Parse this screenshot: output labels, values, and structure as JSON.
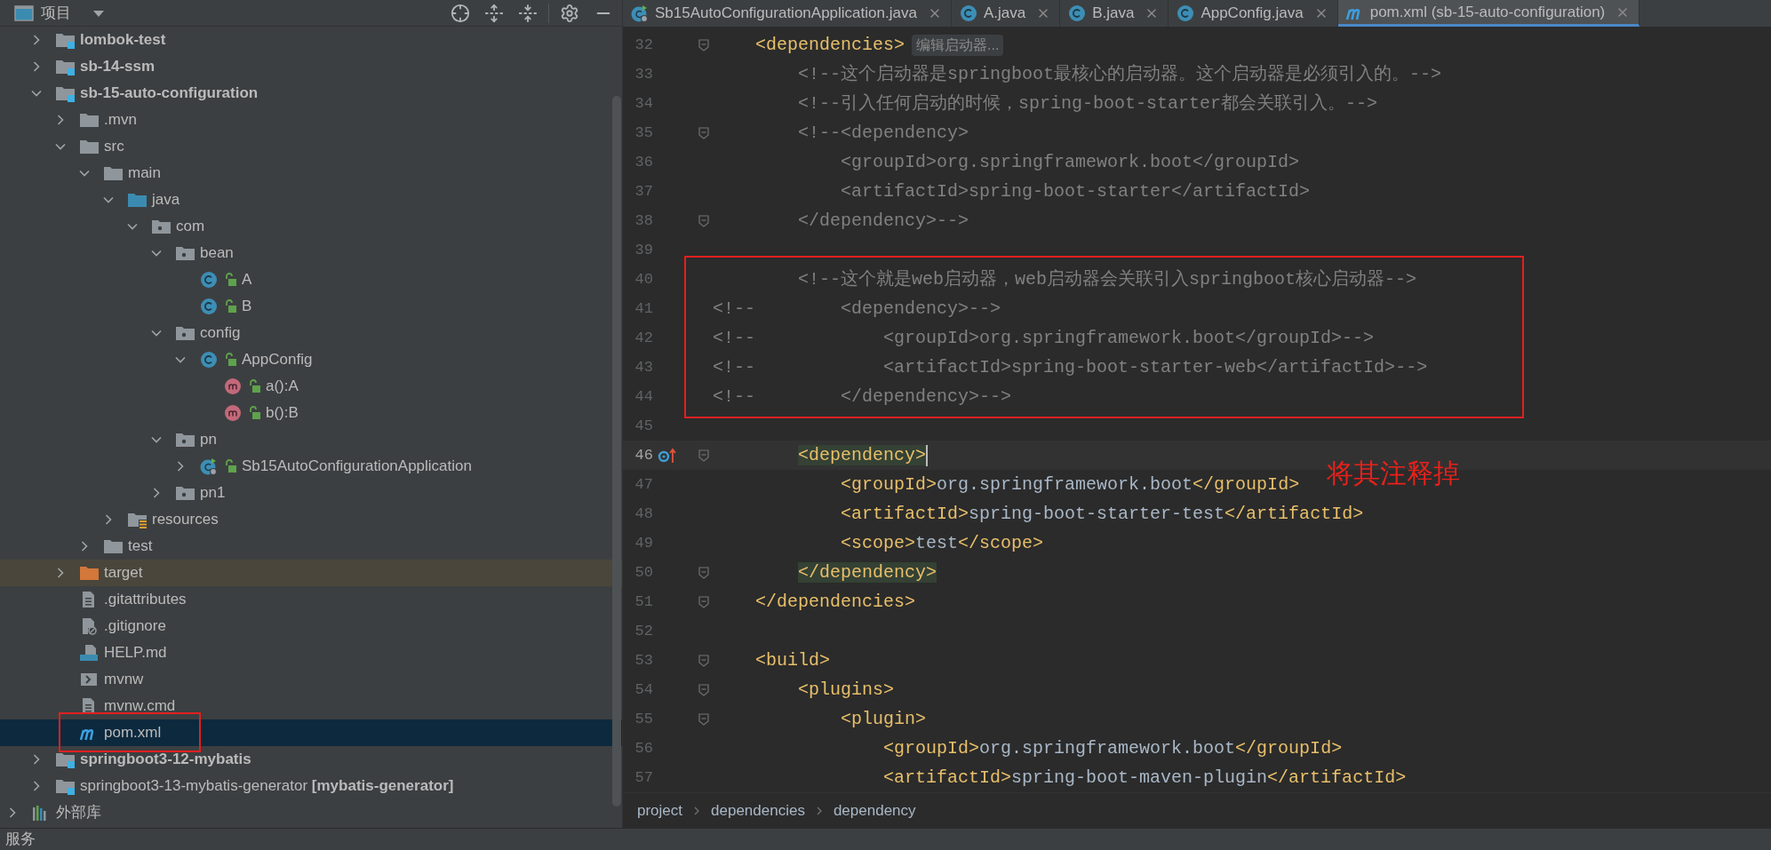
{
  "project_panel": {
    "title": "项目"
  },
  "tree": [
    {
      "label": "lombok-test",
      "kind": "module",
      "bold": true,
      "expanded": false,
      "selected": false
    },
    {
      "label": "sb-14-ssm",
      "kind": "module",
      "bold": true,
      "expanded": false,
      "selected": false
    },
    {
      "label": "sb-15-auto-configuration",
      "kind": "module",
      "bold": true,
      "expanded": true,
      "selected": false,
      "children": [
        {
          "label": ".mvn",
          "kind": "folder",
          "expanded": false,
          "selected": false
        },
        {
          "label": "src",
          "kind": "folder",
          "expanded": true,
          "selected": false,
          "children": [
            {
              "label": "main",
              "kind": "folder",
              "expanded": true,
              "selected": false,
              "children": [
                {
                  "label": "java",
                  "kind": "source_folder",
                  "expanded": true,
                  "selected": false,
                  "children": [
                    {
                      "label": "com",
                      "kind": "package",
                      "expanded": true,
                      "selected": false,
                      "children": [
                        {
                          "label": "bean",
                          "kind": "package",
                          "expanded": true,
                          "selected": false,
                          "children": [
                            {
                              "label": "A",
                              "kind": "class",
                              "selected": false
                            },
                            {
                              "label": "B",
                              "kind": "class",
                              "selected": false
                            }
                          ]
                        },
                        {
                          "label": "config",
                          "kind": "package",
                          "expanded": true,
                          "selected": false,
                          "children": [
                            {
                              "label": "AppConfig",
                              "kind": "class",
                              "expanded": true,
                              "selected": false,
                              "children": [
                                {
                                  "label": "a():A",
                                  "kind": "method",
                                  "selected": false
                                },
                                {
                                  "label": "b():B",
                                  "kind": "method",
                                  "selected": false
                                }
                              ]
                            }
                          ]
                        },
                        {
                          "label": "pn",
                          "kind": "package",
                          "expanded": true,
                          "selected": false,
                          "children": [
                            {
                              "label": "Sb15AutoConfigurationApplication",
                              "kind": "spring_class",
                              "expanded": false,
                              "selected": false
                            }
                          ]
                        },
                        {
                          "label": "pn1",
                          "kind": "package",
                          "expanded": false,
                          "selected": false
                        }
                      ]
                    }
                  ]
                },
                {
                  "label": "resources",
                  "kind": "resources",
                  "expanded": false,
                  "selected": false
                }
              ]
            },
            {
              "label": "test",
              "kind": "folder",
              "expanded": false,
              "selected": false
            }
          ]
        },
        {
          "label": "target",
          "kind": "excluded",
          "expanded": false,
          "selected": false
        },
        {
          "label": ".gitattributes",
          "kind": "file_text",
          "selected": false
        },
        {
          "label": ".gitignore",
          "kind": "gitignore",
          "selected": false
        },
        {
          "label": "HELP.md",
          "kind": "markdown",
          "selected": false
        },
        {
          "label": "mvnw",
          "kind": "script",
          "selected": false
        },
        {
          "label": "mvnw.cmd",
          "kind": "file_text",
          "selected": false
        },
        {
          "label": "pom.xml",
          "kind": "maven",
          "selected": true
        }
      ]
    },
    {
      "label": "springboot3-12-mybatis",
      "kind": "module",
      "bold": true,
      "expanded": false,
      "selected": false
    },
    {
      "label": "springboot3-13-mybatis-generator **[mybatis-generator]**",
      "kind": "module",
      "bold": false,
      "expanded": false,
      "selected": false
    },
    {
      "label": "外部库",
      "kind": "library",
      "expanded": false,
      "selected": false
    }
  ],
  "editor": {
    "tabs": [
      {
        "label": "Sb15AutoConfigurationApplication.java",
        "kind": "spring_class",
        "selected": false
      },
      {
        "label": "A.java",
        "kind": "class",
        "selected": false
      },
      {
        "label": "B.java",
        "kind": "class",
        "selected": false
      },
      {
        "label": "AppConfig.java",
        "kind": "class",
        "selected": false
      },
      {
        "label": "pom.xml (sb-15-auto-configuration)",
        "kind": "maven",
        "selected": true
      }
    ],
    "lines": [
      {
        "number": "32",
        "fold": true,
        "current": false,
        "gutter_mark": false,
        "segments": [
          {
            "kind": "tag",
            "text": "    <dependencies>"
          },
          {
            "kind": "hint",
            "text": "编辑启动器..."
          }
        ]
      },
      {
        "number": "33",
        "fold": false,
        "current": false,
        "gutter_mark": false,
        "segments": [
          {
            "kind": "comment",
            "text": "        <!--这个启动器是springboot最核心的启动器。这个启动器是必须引入的。-->"
          }
        ]
      },
      {
        "number": "34",
        "fold": false,
        "current": false,
        "gutter_mark": false,
        "segments": [
          {
            "kind": "comment",
            "text": "        <!--引入任何启动的时候，spring-boot-starter都会关联引入。-->"
          }
        ]
      },
      {
        "number": "35",
        "fold": true,
        "current": false,
        "gutter_mark": false,
        "segments": [
          {
            "kind": "comment",
            "text": "        <!--<dependency>"
          }
        ]
      },
      {
        "number": "36",
        "fold": false,
        "current": false,
        "gutter_mark": false,
        "segments": [
          {
            "kind": "comment",
            "text": "            <groupId>org.springframework.boot</groupId>"
          }
        ]
      },
      {
        "number": "37",
        "fold": false,
        "current": false,
        "gutter_mark": false,
        "segments": [
          {
            "kind": "comment",
            "text": "            <artifactId>spring-boot-starter</artifactId>"
          }
        ]
      },
      {
        "number": "38",
        "fold": true,
        "current": false,
        "gutter_mark": false,
        "segments": [
          {
            "kind": "comment",
            "text": "        </dependency>-->"
          }
        ]
      },
      {
        "number": "39",
        "fold": false,
        "current": false,
        "gutter_mark": false
      },
      {
        "number": "40",
        "fold": false,
        "current": false,
        "gutter_mark": false,
        "segments": [
          {
            "kind": "comment",
            "text": "        <!--这个就是web启动器，web启动器会关联引入springboot核心启动器-->"
          }
        ]
      },
      {
        "number": "41",
        "fold": false,
        "current": false,
        "gutter_mark": false,
        "segments": [
          {
            "kind": "comment",
            "text": "<!--        <dependency>-->"
          }
        ]
      },
      {
        "number": "42",
        "fold": false,
        "current": false,
        "gutter_mark": false,
        "segments": [
          {
            "kind": "comment",
            "text": "<!--            <groupId>org.springframework.boot</groupId>-->"
          }
        ]
      },
      {
        "number": "43",
        "fold": false,
        "current": false,
        "gutter_mark": false,
        "segments": [
          {
            "kind": "comment",
            "text": "<!--            <artifactId>spring-boot-starter-web</artifactId>-->"
          }
        ]
      },
      {
        "number": "44",
        "fold": false,
        "current": false,
        "gutter_mark": false,
        "segments": [
          {
            "kind": "comment",
            "text": "<!--        </dependency>-->"
          }
        ]
      },
      {
        "number": "45",
        "fold": false,
        "current": false,
        "gutter_mark": false
      },
      {
        "number": "46",
        "fold": true,
        "current": true,
        "gutter_mark": true,
        "segments": [
          {
            "kind": "tag_match",
            "text": "        <dependency>"
          }
        ]
      },
      {
        "number": "47",
        "fold": false,
        "current": false,
        "gutter_mark": false,
        "segments": [
          {
            "kind": "tag",
            "text": "            <groupId>"
          },
          {
            "kind": "text",
            "text": "org.springframework.boot"
          },
          {
            "kind": "tag",
            "text": "</groupId>"
          }
        ]
      },
      {
        "number": "48",
        "fold": false,
        "current": false,
        "gutter_mark": false,
        "segments": [
          {
            "kind": "tag",
            "text": "            <artifactId>"
          },
          {
            "kind": "text",
            "text": "spring-boot-starter-test"
          },
          {
            "kind": "tag",
            "text": "</artifactId>"
          }
        ]
      },
      {
        "number": "49",
        "fold": false,
        "current": false,
        "gutter_mark": false,
        "segments": [
          {
            "kind": "tag",
            "text": "            <scope>"
          },
          {
            "kind": "text",
            "text": "test"
          },
          {
            "kind": "tag",
            "text": "</scope>"
          }
        ]
      },
      {
        "number": "50",
        "fold": true,
        "current": false,
        "gutter_mark": false,
        "segments": [
          {
            "kind": "tag_match",
            "text": "        </dependency>"
          }
        ]
      },
      {
        "number": "51",
        "fold": true,
        "current": false,
        "gutter_mark": false,
        "segments": [
          {
            "kind": "tag",
            "text": "    </dependencies>"
          }
        ]
      },
      {
        "number": "52",
        "fold": false,
        "current": false,
        "gutter_mark": false
      },
      {
        "number": "53",
        "fold": true,
        "current": false,
        "gutter_mark": false,
        "segments": [
          {
            "kind": "tag",
            "text": "    <build>"
          }
        ]
      },
      {
        "number": "54",
        "fold": true,
        "current": false,
        "gutter_mark": false,
        "segments": [
          {
            "kind": "tag",
            "text": "        <plugins>"
          }
        ]
      },
      {
        "number": "55",
        "fold": true,
        "current": false,
        "gutter_mark": false,
        "segments": [
          {
            "kind": "tag",
            "text": "            <plugin>"
          }
        ]
      },
      {
        "number": "56",
        "fold": false,
        "current": false,
        "gutter_mark": false,
        "segments": [
          {
            "kind": "tag",
            "text": "                <groupId>"
          },
          {
            "kind": "text",
            "text": "org.springframework.boot"
          },
          {
            "kind": "tag",
            "text": "</groupId>"
          }
        ]
      },
      {
        "number": "57",
        "fold": false,
        "current": false,
        "gutter_mark": false,
        "segments": [
          {
            "kind": "tag",
            "text": "                <artifactId>"
          },
          {
            "kind": "text",
            "text": "spring-boot-maven-plugin"
          },
          {
            "kind": "tag",
            "text": "</artifactId>"
          }
        ]
      }
    ],
    "annotation": "将其注释掉",
    "breadcrumbs": [
      "project",
      "dependencies",
      "dependency"
    ]
  },
  "status_bar": {
    "label": "服务"
  }
}
